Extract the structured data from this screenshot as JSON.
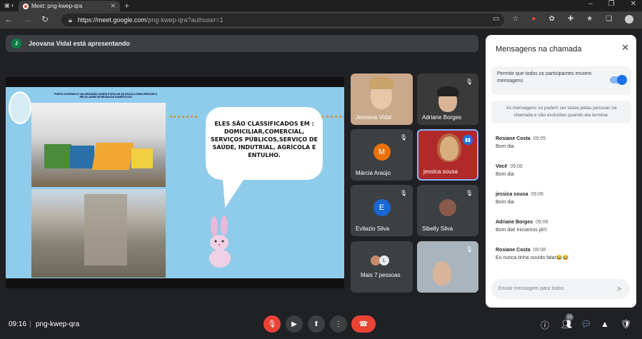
{
  "browser": {
    "tab_title": "Meet: png-kwep-qra",
    "url_host": "https://meet.google.com",
    "url_path": "/png-kwep-qra?authuser=1"
  },
  "banner": {
    "avatar_letter": "J",
    "text": "Jeovana Vidal está apresentando"
  },
  "slide": {
    "header": "PORTO DOCENDO E VALORIZANDO SAÚDE POPULAR NA ESCOLA PARA REDUZIR A RECICLAGEM DE RESÍDUOS DOMÉSTICOS",
    "bubble_text": "ELES SÃO CLASSIFICADOS EM : DOMICILIAR,COMERCIAL, SERVIÇOS PÚBLICOS,SERVIÇO DE SAÚDE, INDUTRIAL, AGRÍCOLA E ENTULHO."
  },
  "participants": [
    {
      "name": "Jeovana Vidal"
    },
    {
      "name": "Adriane Borges"
    },
    {
      "name": "Márcia Araújo",
      "letter": "M",
      "color": "#e8710a"
    },
    {
      "name": "jessica sousa"
    },
    {
      "name": "Evilazio Silva",
      "letter": "E",
      "color": "#1967d2"
    },
    {
      "name": "Sibelly Silva"
    },
    {
      "name": "Mais 7 pessoas",
      "letter": "L"
    },
    {
      "name": ""
    }
  ],
  "chat": {
    "title": "Mensagens na chamada",
    "allow_text": "Permitir que todos os participantes enviem mensagens",
    "notice": "As mensagens só podem ser vistas pelas pessoas na chamada e são excluídas quando ela termina.",
    "messages": [
      {
        "sender": "Rosiane Costa",
        "time": "09:05",
        "text": "Bom dia"
      },
      {
        "sender": "Você",
        "time": "09:06",
        "text": "Bom dia"
      },
      {
        "sender": "jessica sousa",
        "time": "09:06",
        "text": "Bom dia"
      },
      {
        "sender": "Adriane Borges",
        "time": "09:06",
        "text": "Bom dia! iniciamos já!!!"
      },
      {
        "sender": "Rosiane Costa",
        "time": "09:08",
        "text": "Eu nunca tinha ouvido falar😂😂"
      }
    ],
    "input_placeholder": "Enviar mensagem para todos"
  },
  "bottom_bar": {
    "clock": "09:16",
    "meeting_code": "png-kwep-qra",
    "participants_count": "15"
  },
  "icons": {
    "accent": "#1a73e8",
    "danger": "#ea4335"
  }
}
